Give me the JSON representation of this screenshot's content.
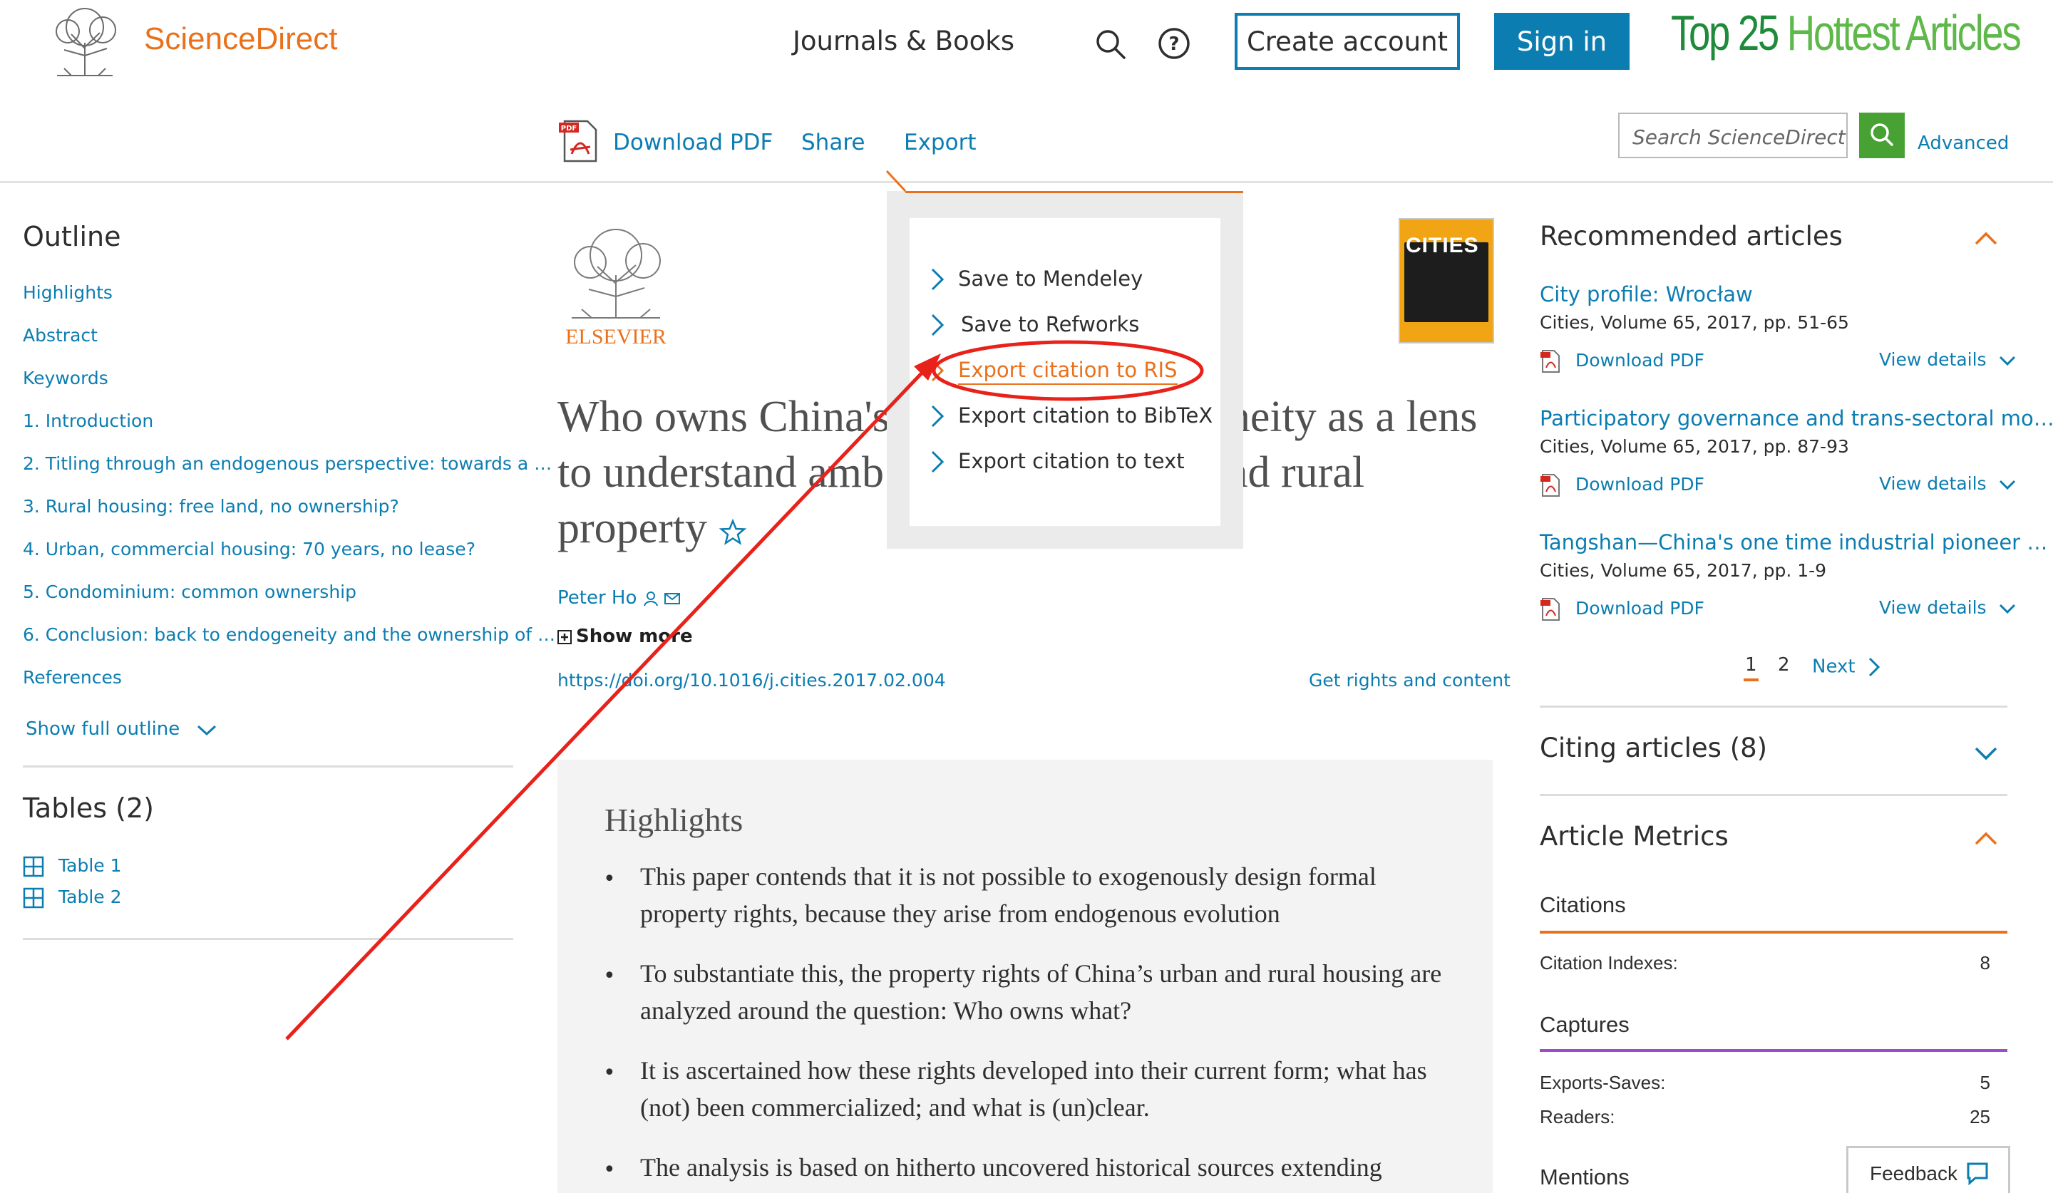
{
  "header": {
    "brand": "ScienceDirect",
    "nav_journals": "Journals & Books",
    "create_account": "Create account",
    "sign_in": "Sign in",
    "banner_top": "Top 25",
    "banner_hot": "Hottest Articles",
    "icons": [
      "search-icon",
      "help-icon"
    ]
  },
  "toolbar": {
    "download_pdf": "Download PDF",
    "share": "Share",
    "export": "Export",
    "search_placeholder": "Search ScienceDirect",
    "advanced": "Advanced"
  },
  "export_menu": {
    "items": [
      "Save to Mendeley",
      "Save to Refworks",
      "Export citation to RIS",
      "Export citation to BibTeX",
      "Export citation to text"
    ],
    "highlighted": "Export citation to RIS"
  },
  "outline": {
    "title": "Outline",
    "items": [
      "Highlights",
      "Abstract",
      "Keywords",
      "1. Introduction",
      "2. Titling through an endogenous perspective: towards a …",
      "3. Rural housing: free land, no ownership?",
      "4. Urban, commercial housing: 70 years, no lease?",
      "5. Condominium: common ownership",
      "6. Conclusion: back to endogeneity and the ownership of …",
      "References"
    ],
    "show_full": "Show full outline"
  },
  "tables": {
    "title": "Tables (2)",
    "items": [
      "Table 1",
      "Table 2"
    ]
  },
  "article": {
    "publisher": "ELSEVIER",
    "journal_cover": "CITIES",
    "title_line1": "Who owns China's",
    "title_line1_tail": "neity as a lens",
    "title_line2": "to understand amb",
    "title_line2_tail": "and rural",
    "title_line3": "property",
    "author": "Peter Ho",
    "show_more": "Show more",
    "doi": "https://doi.org/10.1016/j.cities.2017.02.004",
    "rights": "Get rights and content",
    "highlights_title": "Highlights",
    "highlights": [
      "This paper contends that it is not possible to exogenously design formal property rights, because they arise from endogenous evolution",
      "To substantiate this, the property rights of China’s urban and rural housing are analyzed around the question: Who owns what?",
      "It is ascertained how these rights developed into their current form; what has (not) been commercialized; and what is (un)clear.",
      "The analysis is based on hitherto uncovered historical sources extending"
    ]
  },
  "recommended": {
    "title": "Recommended articles",
    "items": [
      {
        "title": "City profile: Wrocław",
        "meta": "Cities, Volume 65, 2017, pp. 51-65"
      },
      {
        "title": "Participatory governance and trans-sectoral mo…",
        "meta": "Cities, Volume 65, 2017, pp. 87-93"
      },
      {
        "title": "Tangshan—China's one time industrial pioneer …",
        "meta": "Cities, Volume 65, 2017, pp. 1-9"
      }
    ],
    "download_pdf": "Download PDF",
    "view_details": "View details",
    "pagination": {
      "page1": "1",
      "page2": "2",
      "next": "Next"
    }
  },
  "citing": {
    "title": "Citing articles (8)"
  },
  "metrics": {
    "title": "Article Metrics",
    "citations_head": "Citations",
    "citation_indexes_label": "Citation Indexes:",
    "citation_indexes_value": "8",
    "captures_head": "Captures",
    "exports_label": "Exports-Saves:",
    "exports_value": "5",
    "readers_label": "Readers:",
    "readers_value": "25",
    "mentions_head": "Mentions"
  },
  "feedback": "Feedback",
  "colors": {
    "accent_orange": "#e9711c",
    "link_blue": "#0c7db1",
    "search_green": "#47a133",
    "annotation_red": "#e8221a",
    "captures_purple": "#9b4dca"
  }
}
